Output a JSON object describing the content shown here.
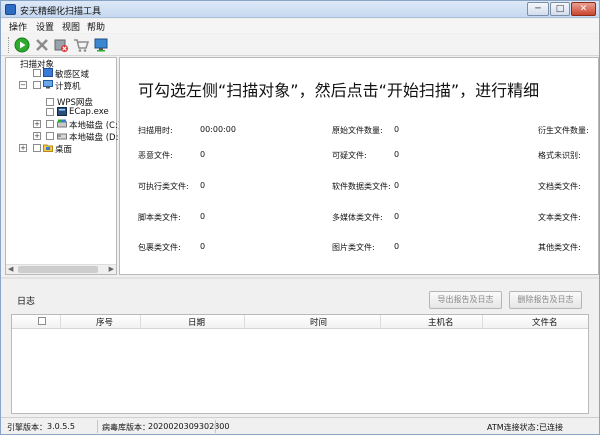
{
  "window": {
    "title": "安天精细化扫描工具"
  },
  "menu": {
    "items": [
      "操作",
      "设置",
      "视图",
      "帮助"
    ]
  },
  "toolbar": {
    "buttons": [
      "start-scan-icon",
      "stop-scan-icon",
      "delete-icon",
      "cart-icon",
      "monitor-icon"
    ],
    "colors": {
      "start": "#2eaa2e",
      "accent": "#2e6bc3"
    }
  },
  "tree": {
    "header": "扫描对象",
    "items": [
      {
        "label": "敏感区域",
        "icon": "sensitive-area-icon"
      },
      {
        "label": "计算机",
        "icon": "computer-icon"
      },
      {
        "label": "WPS网盘",
        "icon": "wps-cloud-icon"
      },
      {
        "label": "ECap.exe",
        "icon": "exe-icon"
      },
      {
        "label": "本地磁盘 (C:)",
        "icon": "local-disk-c-icon"
      },
      {
        "label": "本地磁盘 (D:)",
        "icon": "local-disk-d-icon"
      },
      {
        "label": "桌面",
        "icon": "desktop-folder-icon"
      }
    ]
  },
  "main": {
    "hint": "可勾选左侧“扫描对象”，然后点击“开始扫描”，进行精细",
    "stats": [
      {
        "label": "扫描用时:",
        "value": "00:00:00"
      },
      {
        "label": "原始文件数量:",
        "value": "0"
      },
      {
        "label": "衍生文件数量:",
        "value": ""
      },
      {
        "label": "恶意文件:",
        "value": "0"
      },
      {
        "label": "可疑文件:",
        "value": "0"
      },
      {
        "label": "格式未识别:",
        "value": ""
      },
      {
        "label": "可执行类文件:",
        "value": "0"
      },
      {
        "label": "软件数据类文件:",
        "value": "0"
      },
      {
        "label": "文档类文件:",
        "value": ""
      },
      {
        "label": "脚本类文件:",
        "value": "0"
      },
      {
        "label": "多媒体类文件:",
        "value": "0"
      },
      {
        "label": "文本类文件:",
        "value": ""
      },
      {
        "label": "包裹类文件:",
        "value": "0"
      },
      {
        "label": "图片类文件:",
        "value": "0"
      },
      {
        "label": "其他类文件:",
        "value": ""
      }
    ]
  },
  "log": {
    "title": "日志",
    "export_button": "导出报告及日志",
    "delete_button": "删除报告及日志",
    "columns": [
      "序号",
      "日期",
      "时间",
      "主机名",
      "文件名"
    ]
  },
  "status": {
    "engine_label": "引擎版本：",
    "engine_value": "3.0.5.5",
    "virus_db_label": "病毒库版本：",
    "virus_db_value": "2020020309302800",
    "atm_label": "ATM连接状态：",
    "atm_value": "已连接"
  }
}
